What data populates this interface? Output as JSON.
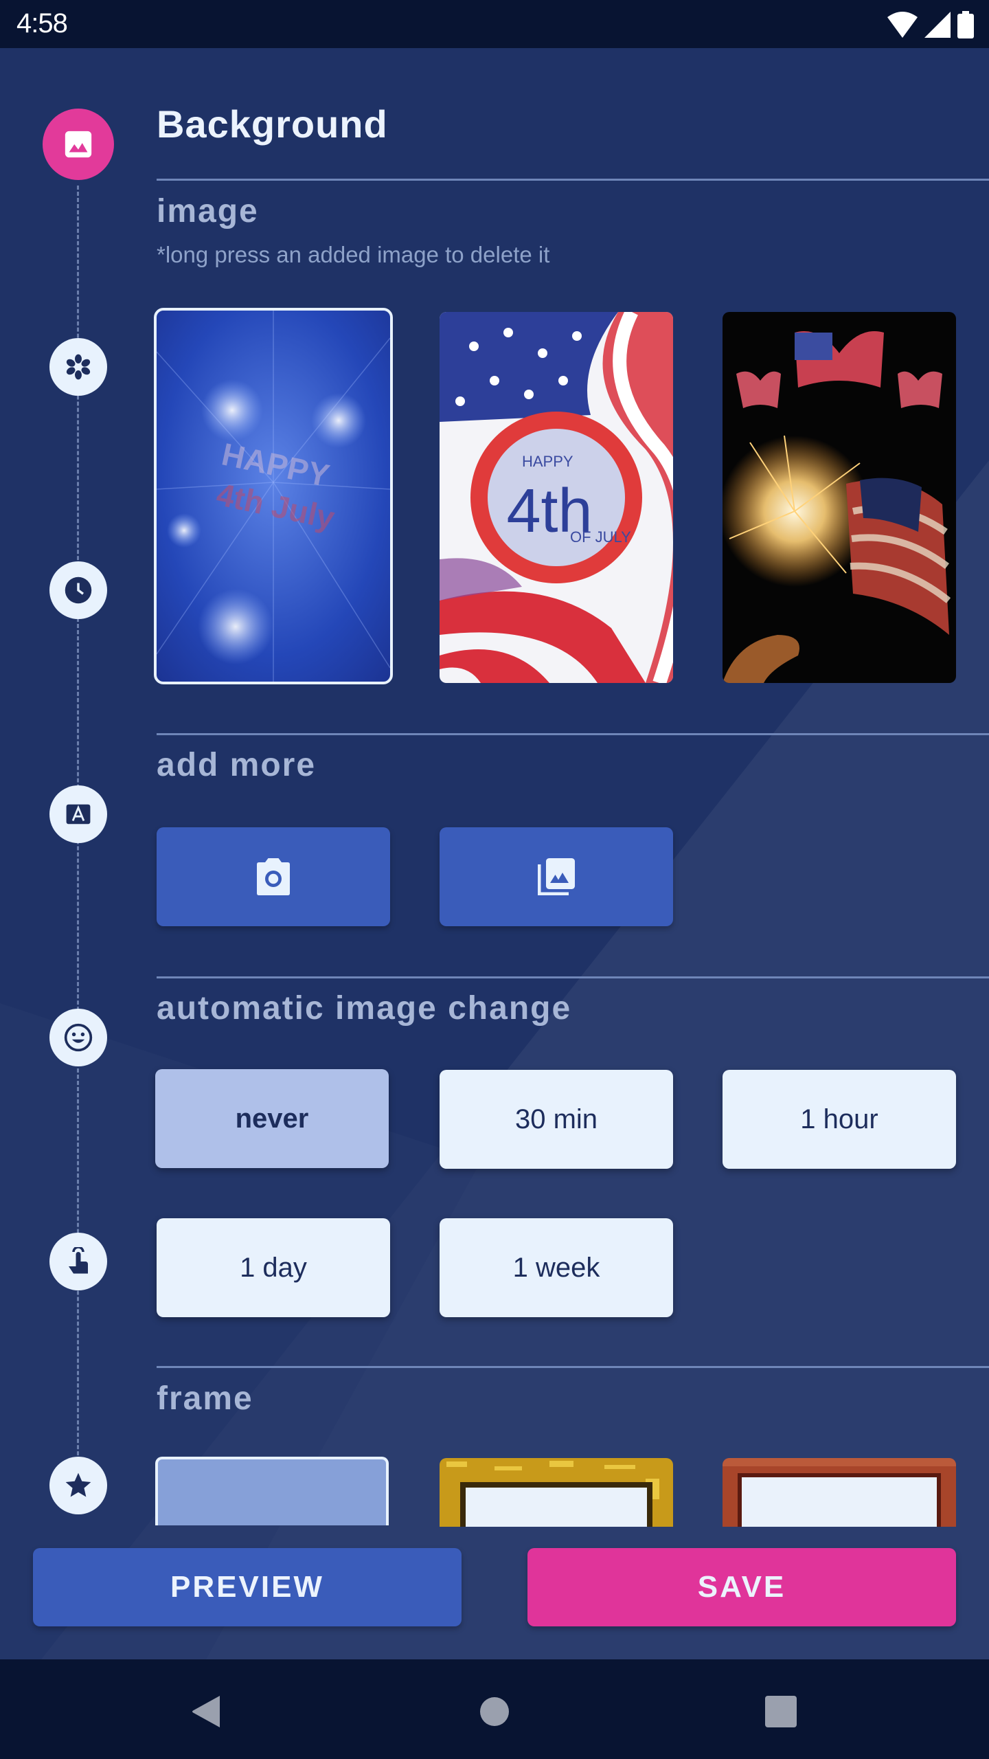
{
  "status_bar": {
    "time": "4:58",
    "icons": [
      "wifi-icon",
      "cell-signal-icon",
      "battery-icon"
    ]
  },
  "header": {
    "title": "Background",
    "icon": "image-icon",
    "accent_color": "#e23a9a"
  },
  "timeline": {
    "nodes": [
      {
        "icon": "image-icon",
        "active": true
      },
      {
        "icon": "flower-icon",
        "active": false
      },
      {
        "icon": "clock-icon",
        "active": false
      },
      {
        "icon": "text-icon",
        "active": false
      },
      {
        "icon": "smiley-icon",
        "active": false
      },
      {
        "icon": "touch-icon",
        "active": false
      },
      {
        "icon": "star-icon",
        "active": false
      }
    ]
  },
  "image_section": {
    "label": "image",
    "hint": "*long press an added image to delete it",
    "thumbnails": [
      {
        "name": "blue-fireworks-happy-4th-of-july",
        "selected": true
      },
      {
        "name": "happy-4th-of-july-flag-badge",
        "selected": false,
        "text_main": "4th",
        "text_top": "HAPPY",
        "text_bottom": "OF JULY"
      },
      {
        "name": "sparkler-flag-butterflies",
        "selected": false
      }
    ]
  },
  "add_more": {
    "label": "add more",
    "buttons": [
      {
        "icon": "camera-icon"
      },
      {
        "icon": "gallery-icon"
      }
    ]
  },
  "auto_change": {
    "label": "automatic image change",
    "options": [
      "never",
      "30 min",
      "1 hour",
      "1 day",
      "1 week"
    ],
    "selected": "never"
  },
  "frame": {
    "label": "frame",
    "options": [
      {
        "name": "no-frame",
        "selected": true
      },
      {
        "name": "gold-glitter-frame",
        "selected": false
      },
      {
        "name": "wood-frame",
        "selected": false
      }
    ]
  },
  "footer": {
    "preview_label": "PREVIEW",
    "save_label": "SAVE",
    "preview_color": "#3a5cba",
    "save_color": "#e0349a"
  },
  "nav_bar": {
    "icons": [
      "back-icon",
      "home-icon",
      "recents-icon"
    ]
  }
}
